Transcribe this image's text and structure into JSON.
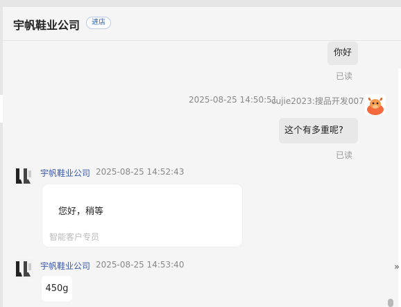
{
  "header": {
    "shop_name": "宇帆鞋业公司",
    "badge": "进店"
  },
  "messages": {
    "m1": {
      "text": "你好",
      "status": "已读"
    },
    "m2": {
      "time": "2025-08-25 14:50:51",
      "sender": "cujie2023:搜品开发007",
      "text": "这个有多重呢?",
      "status": "已读"
    },
    "m3": {
      "sender": "宇帆鞋业公司",
      "time": "2025-08-25 14:52:43",
      "text": "您好，稍等",
      "footer": "智能客户专员"
    },
    "m4": {
      "sender": "宇帆鞋业公司",
      "time": "2025-08-25 14:53:40",
      "text": "450g"
    }
  },
  "side": {
    "arrow": "»"
  },
  "icons": {
    "shop_avatar": "shoes-avatar-icon",
    "user_avatar": "cow-avatar-icon"
  }
}
